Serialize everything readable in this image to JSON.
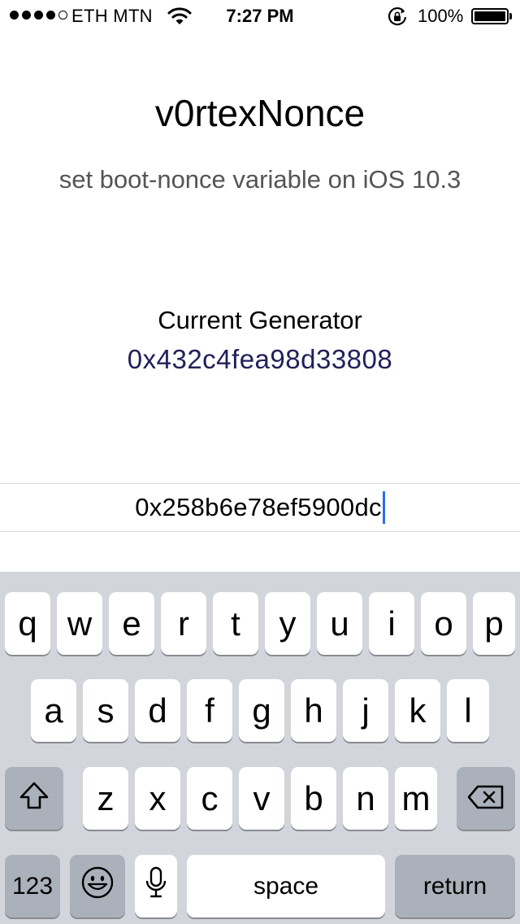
{
  "status_bar": {
    "carrier": "ETH MTN",
    "time": "7:27 PM",
    "battery": "100%",
    "signal_bars": 4,
    "signal_total": 5,
    "icons": [
      "wifi-icon",
      "rotation-lock-icon",
      "battery-icon"
    ]
  },
  "app": {
    "title": "v0rtexNonce",
    "subtitle": "set boot-nonce variable on iOS 10.3"
  },
  "generator": {
    "label": "Current Generator",
    "value": "0x432c4fea98d33808"
  },
  "nonce_input": {
    "value": "0x258b6e78ef5900dc"
  },
  "keyboard": {
    "row1": [
      "q",
      "w",
      "e",
      "r",
      "t",
      "y",
      "u",
      "i",
      "o",
      "p"
    ],
    "row2": [
      "a",
      "s",
      "d",
      "f",
      "g",
      "h",
      "j",
      "k",
      "l"
    ],
    "row3": [
      "z",
      "x",
      "c",
      "v",
      "b",
      "n",
      "m"
    ],
    "numbers_label": "123",
    "space_label": "space",
    "return_label": "return",
    "icons": [
      "shift-icon",
      "backspace-icon",
      "emoji-icon",
      "microphone-icon"
    ]
  },
  "colors": {
    "keyboard_bg": "#d2d5db",
    "key_bg": "#ffffff",
    "key_dark_bg": "#abb1ba",
    "caret": "#2a6df5",
    "generator_value": "#22205a"
  }
}
